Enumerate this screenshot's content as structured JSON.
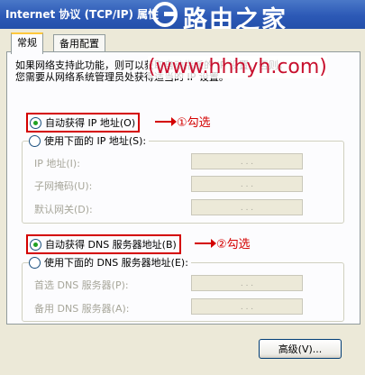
{
  "window": {
    "title": "Internet 协议 (TCP/IP) 属性",
    "watermark_title": "路由之家",
    "watermark_url": "(www.hhhyh.com)"
  },
  "tabs": [
    {
      "label": "常规",
      "selected": true
    },
    {
      "label": "备用配置",
      "selected": false
    }
  ],
  "description": "如果网络支持此功能，则可以获取自动指派的 IP 设置。否则，\n您需要从网络系统管理员处获得适当的 IP 设置。",
  "ip_section": {
    "auto_label": "自动获得 IP 地址(O)",
    "auto_selected": true,
    "annotation": "①勾选",
    "manual_label": "使用下面的 IP 地址(S):",
    "fields": [
      {
        "label": "IP 地址(I):",
        "value": ". . ."
      },
      {
        "label": "子网掩码(U):",
        "value": ". . ."
      },
      {
        "label": "默认网关(D):",
        "value": ". . ."
      }
    ]
  },
  "dns_section": {
    "auto_label": "自动获得 DNS 服务器地址(B)",
    "auto_selected": true,
    "annotation": "②勾选",
    "manual_label": "使用下面的 DNS 服务器地址(E):",
    "fields": [
      {
        "label": "首选 DNS 服务器(P):",
        "value": ". . ."
      },
      {
        "label": "备用 DNS 服务器(A):",
        "value": ". . ."
      }
    ]
  },
  "buttons": {
    "advanced": "高级(V)..."
  },
  "colors": {
    "titlebar": "#2c59b6",
    "annotation": "#d40000",
    "radio_dot": "#21a121"
  },
  "icons": [
    "router-logo-icon",
    "arrow-right-icon"
  ]
}
